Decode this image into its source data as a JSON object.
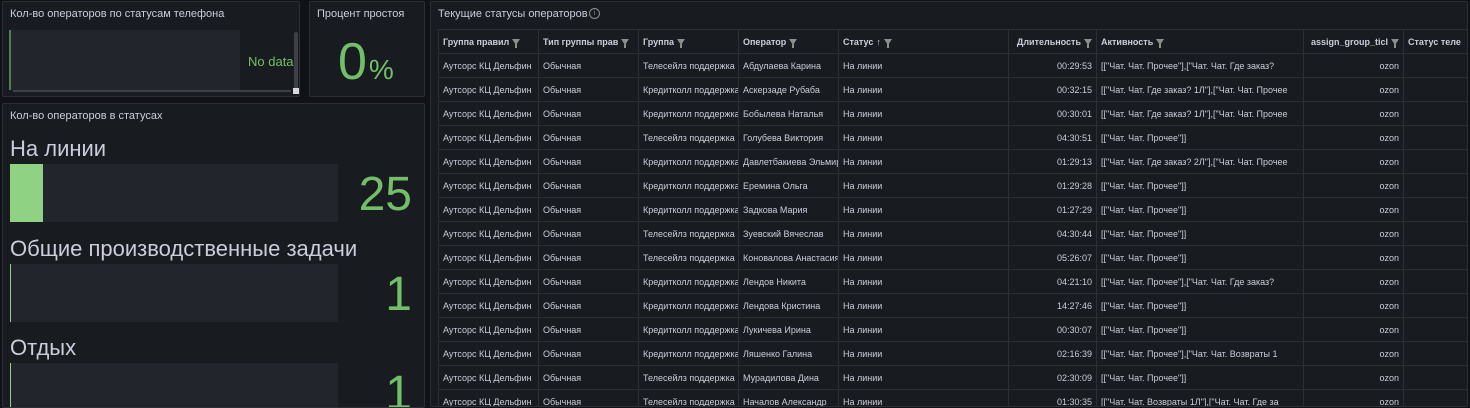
{
  "panels": {
    "phone_status": {
      "title": "Кол-во операторов по статусам телефона",
      "no_data": "No data"
    },
    "idle": {
      "title": "Процент простоя",
      "value": "0",
      "unit": "%"
    },
    "operators_in_status": {
      "title": "Кол-во операторов в статусах",
      "items": [
        {
          "name": "На линии",
          "value": "25",
          "fill": 0.1
        },
        {
          "name": "Общие производственные задачи",
          "value": "1",
          "fill": 0.004
        },
        {
          "name": "Отдых",
          "value": "1",
          "fill": 0.004
        }
      ]
    },
    "current_statuses": {
      "title": "Текущие статусы операторов",
      "info_icon": "info-icon",
      "columns": [
        "Группа правил",
        "Тип группы прав",
        "Группа",
        "Оператор",
        "Статус",
        "Длительность",
        "Активность",
        "assign_group_ticl",
        "Статус теле"
      ],
      "rows": [
        [
          "Аутсорс КЦ Дельфин",
          "Обычная",
          "Телесейлз поддержка",
          "Абдулаева Карина",
          "На линии",
          "00:29:53",
          "[[\"Чат. Чат. Прочее\"],[\"Чат. Чат. Где заказ?",
          "ozon",
          ""
        ],
        [
          "Аутсорс КЦ Дельфин",
          "Обычная",
          "Кредитколл поддержка",
          "Аскерзаде Рубаба",
          "На линии",
          "00:32:15",
          "[[\"Чат. Чат. Где заказ? 1Л\"],[\"Чат. Чат. Прочее",
          "ozon",
          ""
        ],
        [
          "Аутсорс КЦ Дельфин",
          "Обычная",
          "Кредитколл поддержка",
          "Бобылева Наталья",
          "На линии",
          "00:30:01",
          "[[\"Чат. Чат. Где заказ? 1Л\"],[\"Чат. Чат. Прочее",
          "ozon",
          ""
        ],
        [
          "Аутсорс КЦ Дельфин",
          "Обычная",
          "Телесейлз поддержка",
          "Голубева Виктория",
          "На линии",
          "04:30:51",
          "[[\"Чат. Чат. Прочее\"]]",
          "ozon",
          ""
        ],
        [
          "Аутсорс КЦ Дельфин",
          "Обычная",
          "Кредитколл поддержка",
          "Давлетбакиева Эльмира",
          "На линии",
          "01:29:13",
          "[[\"Чат. Чат. Где заказ? 2Л\"],[\"Чат. Чат. Прочее",
          "ozon",
          ""
        ],
        [
          "Аутсорс КЦ Дельфин",
          "Обычная",
          "Кредитколл поддержка",
          "Еремина Ольга",
          "На линии",
          "01:29:28",
          "[[\"Чат. Чат. Прочее\"]]",
          "ozon",
          ""
        ],
        [
          "Аутсорс КЦ Дельфин",
          "Обычная",
          "Кредитколл поддержка",
          "Задкова Мария",
          "На линии",
          "01:27:29",
          "[[\"Чат. Чат. Прочее\"]]",
          "ozon",
          ""
        ],
        [
          "Аутсорс КЦ Дельфин",
          "Обычная",
          "Телесейлз поддержка",
          "Зуевский Вячеслав",
          "На линии",
          "04:30:44",
          "[[\"Чат. Чат. Прочее\"]]",
          "ozon",
          ""
        ],
        [
          "Аутсорс КЦ Дельфин",
          "Обычная",
          "Телесейлз поддержка",
          "Коновалова Анастасия",
          "На линии",
          "05:26:07",
          "[[\"Чат. Чат. Прочее\"]]",
          "ozon",
          ""
        ],
        [
          "Аутсорс КЦ Дельфин",
          "Обычная",
          "Кредитколл поддержка",
          "Лендов Никита",
          "На линии",
          "04:21:10",
          "[[\"Чат. Чат. Прочее\"],[\"Чат. Чат. Где заказ?",
          "ozon",
          ""
        ],
        [
          "Аутсорс КЦ Дельфин",
          "Обычная",
          "Кредитколл поддержка",
          "Лендова Кристина",
          "На линии",
          "14:27:46",
          "[[\"Чат. Чат. Прочее\"]]",
          "ozon",
          ""
        ],
        [
          "Аутсорс КЦ Дельфин",
          "Обычная",
          "Кредитколл поддержка",
          "Лукичева Ирина",
          "На линии",
          "00:30:07",
          "[[\"Чат. Чат. Прочее\"]]",
          "ozon",
          ""
        ],
        [
          "Аутсорс КЦ Дельфин",
          "Обычная",
          "Кредитколл поддержка",
          "Ляшенко Галина",
          "На линии",
          "02:16:39",
          "[[\"Чат. Чат. Прочее\"],[\"Чат. Чат. Возвраты 1",
          "ozon",
          ""
        ],
        [
          "Аутсорс КЦ Дельфин",
          "Обычная",
          "Телесейлз поддержка",
          "Мурадилова Дина",
          "На линии",
          "02:30:09",
          "[[\"Чат. Чат. Прочее\"]]",
          "ozon",
          ""
        ],
        [
          "Аутсорс КЦ Дельфин",
          "Обычная",
          "Телесейлз поддержка",
          "Началов Александр",
          "На линии",
          "01:30:35",
          "[[\"Чат. Чат. Возвраты 1Л\"],[\"Чат. Чат. Где за",
          "ozon",
          ""
        ]
      ]
    }
  }
}
